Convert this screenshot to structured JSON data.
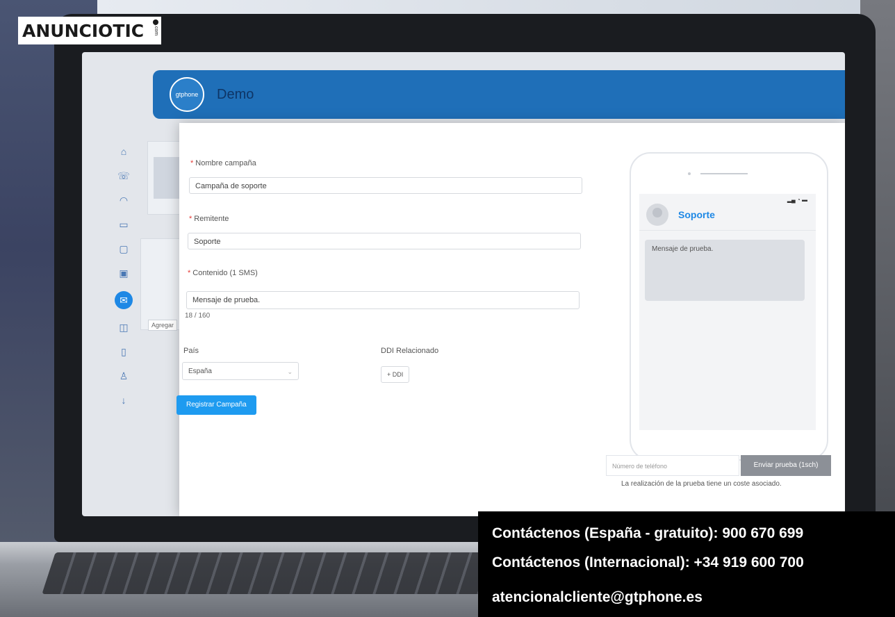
{
  "brand": {
    "name": "ANUNCIOTIC",
    "suffix": ".com"
  },
  "app": {
    "title": "Demo",
    "logo_text": "gtphone"
  },
  "sidebar": {
    "items": [
      {
        "icon": "home-icon"
      },
      {
        "icon": "phone-icon"
      },
      {
        "icon": "headset-icon"
      },
      {
        "icon": "card-icon"
      },
      {
        "icon": "fax-icon"
      },
      {
        "icon": "contacts-icon"
      },
      {
        "icon": "sms-icon",
        "active": true
      },
      {
        "icon": "book-icon"
      },
      {
        "icon": "document-icon"
      },
      {
        "icon": "user-icon"
      },
      {
        "icon": "download-icon"
      }
    ]
  },
  "background": {
    "card_button": "Agregar"
  },
  "form": {
    "campaign_name": {
      "label": "Nombre campaña",
      "value": "Campaña de soporte"
    },
    "sender": {
      "label": "Remitente",
      "value": "Soporte"
    },
    "content": {
      "label": "Contenido (1 SMS)",
      "value": "Mensaje de prueba.",
      "counter": "18 / 160"
    },
    "country": {
      "label": "País",
      "value": "España"
    },
    "ddi": {
      "label": "DDI Relacionado",
      "button": "+ DDI"
    },
    "submit": "Registrar Campaña"
  },
  "preview": {
    "contact_name": "Soporte",
    "message": "Mensaje de prueba.",
    "phone_placeholder": "Número de teléfono",
    "send_button": "Enviar prueba (1sch)",
    "note": "La realización de la prueba tiene un coste asociado."
  },
  "contact": {
    "spain": "Contáctenos (España - gratuito): 900 670 699",
    "international": "Contáctenos (Internacional): +34 919 600 700",
    "email": "atencionalcliente@gtphone.es"
  }
}
